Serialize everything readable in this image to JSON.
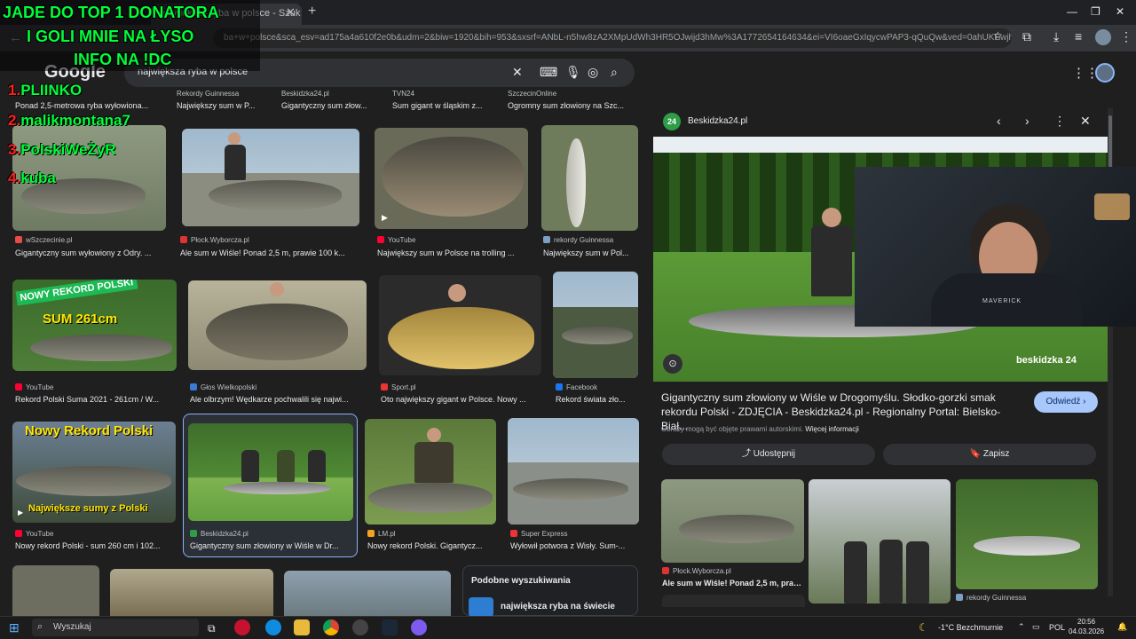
{
  "browser": {
    "tab_title": "najwieksza ryba w polsce - Szuk",
    "url": "ba+w+polsce&sca_esv=ad175a4a610f2e0b&udm=2&biw=1920&bih=953&sxsrf=ANbL-n5hw8zA2XMpUdWh3HR5OJwijd3hMw%3A1772654164634&ei=VI6oaeGxIqycwPAP3-qQuQw&ved=0ahUKEwjhq6u..."
  },
  "google": {
    "logo": "Google",
    "query": "największa ryba w polsce"
  },
  "top_row": [
    {
      "source": "Ponad 2,5-metrowa ryba wyłowiona..."
    },
    {
      "source": "Rekordy Guinnessa",
      "caption": "Największy sum w P..."
    },
    {
      "source": "Beskidzka24.pl",
      "caption": "Gigantyczny sum złow..."
    },
    {
      "source": "TVN24",
      "caption": "Sum gigant w śląskim z..."
    },
    {
      "source": "SzczecinOnline",
      "caption": "Ogromny sum złowiony na Szc..."
    }
  ],
  "results": [
    {
      "source": "wSzczecinie.pl",
      "caption": "Gigantyczny sum wyłowiony z Odry. ...",
      "fav": "#e94a4a"
    },
    {
      "source": "Płock.Wyborcza.pl",
      "caption": "Ale sum w Wiśle! Ponad 2,5 m, prawie 100 k...",
      "fav": "#ffffff"
    },
    {
      "source": "YouTube",
      "caption": "Największy sum w Polsce na trolling ...",
      "fav": "#ff0033"
    },
    {
      "source": "rekordy Guinnessa",
      "caption": "Największy sum w Pol...",
      "fav": "#7aa0c4"
    },
    {
      "source": "YouTube",
      "caption": "Rekord Polski Suma 2021 - 261cm / W...",
      "fav": "#ff0033"
    },
    {
      "source": "Głos Wielkopolski",
      "caption": "Ale olbrzym! Wędkarze pochwalili się najwi...",
      "fav": "#3a7bd5"
    },
    {
      "source": "Sport.pl",
      "caption": "Oto największy gigant w Polsce. Nowy ...",
      "fav": "#e33"
    },
    {
      "source": "Facebook",
      "caption": "Rekord świata zło...",
      "fav": "#1877f2"
    },
    {
      "source": "YouTube",
      "caption": "Nowy rekord Polski - sum 260 cm i 102...",
      "fav": "#ff0033"
    },
    {
      "source": "Beskidzka24.pl",
      "caption": "Gigantyczny sum złowiony w Wiśle w Dr...",
      "fav": "#2e9d47"
    },
    {
      "source": "LM.pl",
      "caption": "Nowy rekord Polski. Gigantycz...",
      "fav": "#f6a21e"
    },
    {
      "source": "Super Express",
      "caption": "Wyłowił potwora z Wisły. Sum-...",
      "fav": "#e33"
    }
  ],
  "thumb_text": {
    "nowy_rekord": "NOWY REKORD POLSKI",
    "sum_size": "SUM 261cm",
    "nowy_rekord2": "Nowy Rekord Polski",
    "najwieksze": "Największe sumy z Polski"
  },
  "similar": {
    "title": "Podobne wyszukiwania",
    "item": "największa ryba na świecie"
  },
  "panel": {
    "site": "Beskidzka24.pl",
    "fav_text": "24",
    "brand": "beskidzka 24",
    "title": "Gigantyczny sum złowiony w Wiśle w Drogomyślu. Słodko-gorzki smak rekordu Polski - ZDJĘCIA - Beskidzka24.pl - Regionalny Portal: Bielsko-Biał...",
    "visit": "Odwiedź ›",
    "note": "Obrazy mogą być objęte prawami autorskimi.",
    "note_link": "Więcej informacji",
    "share": "Udostępnij",
    "save": "Zapisz",
    "related": [
      {
        "source": "Płock.Wyborcza.pl",
        "caption": "Ale sum w Wiśle! Ponad 2,5 m, prawie..."
      },
      {
        "source": "",
        "caption": ""
      },
      {
        "source": "rekordy Guinnessa",
        "caption": ""
      }
    ]
  },
  "overlay": {
    "line1": "JADE DO TOP 1 DONATORA",
    "line2": "I GOLI MNIE NA ŁYSO",
    "line3": "INFO NA !DC",
    "ranks": [
      {
        "n": "1.",
        "name": "PLIINKO"
      },
      {
        "n": "2.",
        "name": "malikmontana7"
      },
      {
        "n": "3.",
        "name": "PolskiWeŻyR"
      },
      {
        "n": "4.",
        "name": "kuba"
      }
    ],
    "shirt": "MAVERICK"
  },
  "taskbar": {
    "search": "Wyszukaj",
    "weather": "-1°C Bezchmurnie",
    "lang": "POL",
    "time": "20:56",
    "date": "04.03.2026"
  }
}
